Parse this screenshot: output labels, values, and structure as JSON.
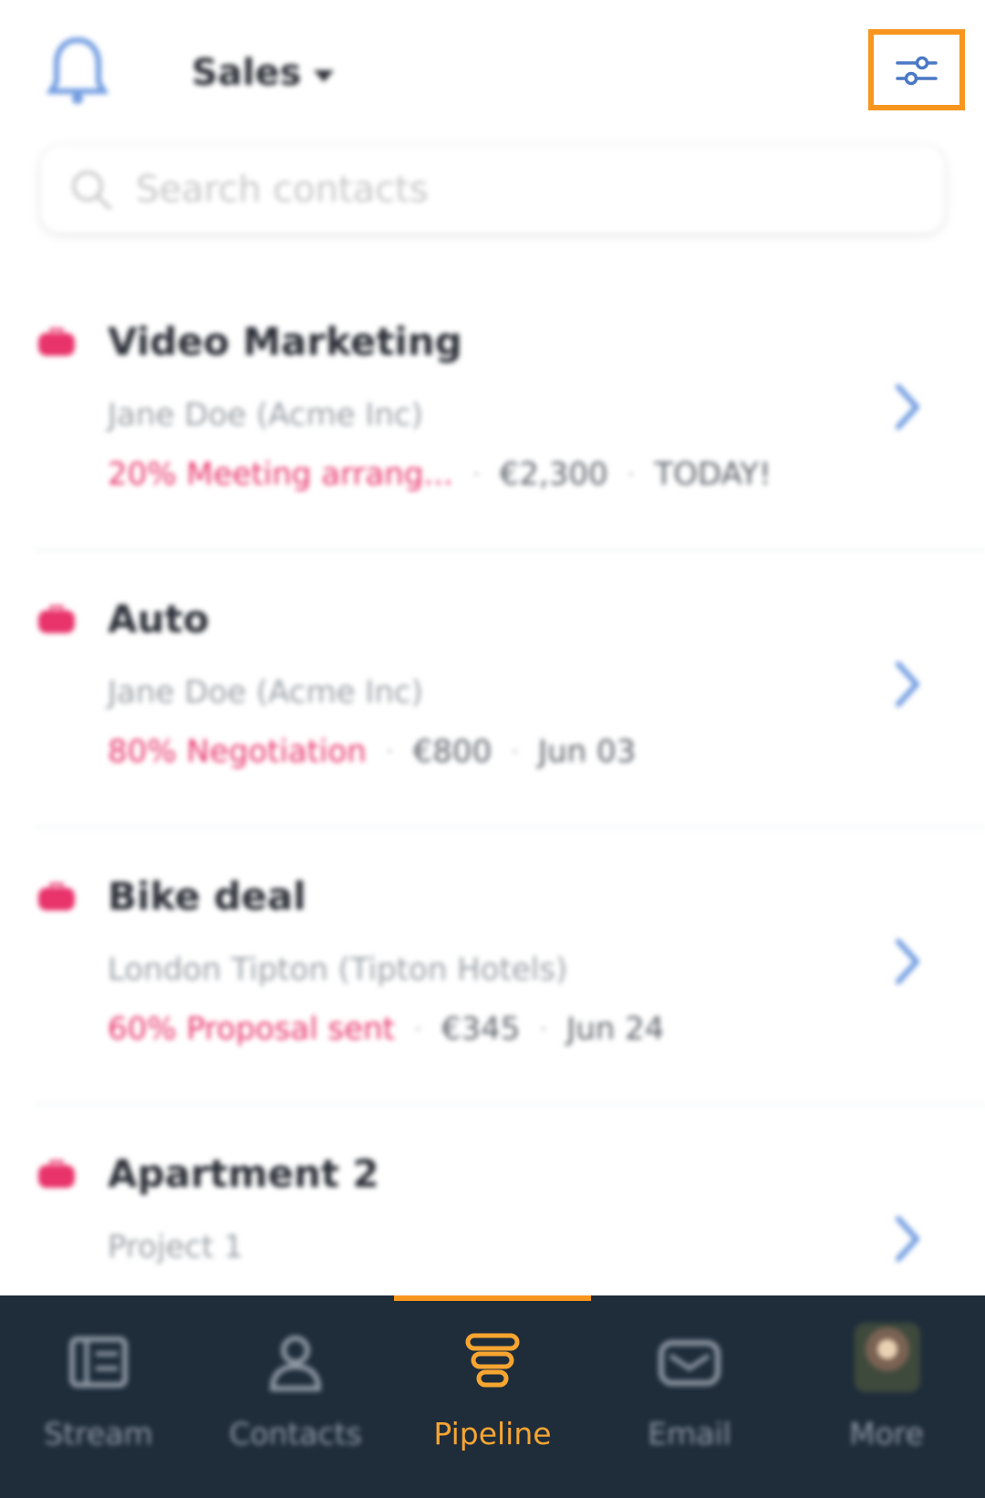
{
  "header": {
    "pipeline_name": "Sales",
    "filter_icon": "sliders-icon",
    "notifications_icon": "bell-icon"
  },
  "search": {
    "placeholder": "Search contacts"
  },
  "deals": [
    {
      "title": "Video Marketing",
      "contact": "Jane Doe (Acme Inc)",
      "stage": "20% Meeting arrang...",
      "value": "€2,300",
      "date": "TODAY!"
    },
    {
      "title": "Auto",
      "contact": "Jane Doe (Acme Inc)",
      "stage": "80% Negotiation",
      "value": "€800",
      "date": "Jun 03"
    },
    {
      "title": "Bike deal",
      "contact": "London Tipton (Tipton Hotels)",
      "stage": "60% Proposal sent",
      "value": "€345",
      "date": "Jun 24"
    },
    {
      "title": "Apartment 2",
      "contact": "Project 1",
      "stage": "",
      "value": "",
      "date": ""
    }
  ],
  "bottom_nav": {
    "active": "Pipeline",
    "items": [
      {
        "label": "Stream",
        "icon": "stream-icon"
      },
      {
        "label": "Contacts",
        "icon": "contacts-icon"
      },
      {
        "label": "Pipeline",
        "icon": "pipeline-icon"
      },
      {
        "label": "Email",
        "icon": "email-icon"
      },
      {
        "label": "More",
        "icon": "avatar"
      }
    ]
  },
  "colors": {
    "accent": "#f7961e",
    "stage": "#e8336b",
    "nav_bg": "#1f2d3b",
    "link_blue": "#4a78c4"
  }
}
